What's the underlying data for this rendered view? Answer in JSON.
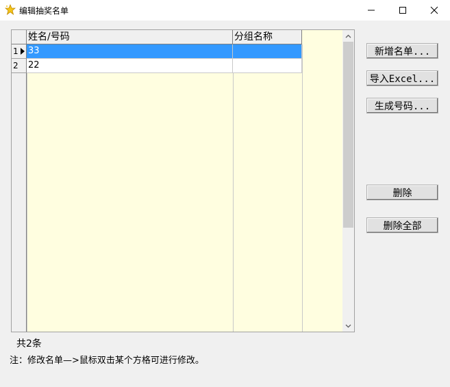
{
  "window": {
    "title": "编辑抽奖名单",
    "icon": "star-icon"
  },
  "grid": {
    "columns": [
      "姓名/号码",
      "分组名称"
    ],
    "rows": [
      {
        "index": "1",
        "name": "33",
        "group": "",
        "selected": true
      },
      {
        "index": "2",
        "name": "22",
        "group": "",
        "selected": false
      }
    ]
  },
  "buttons": {
    "add_list": "新增名单...",
    "import_excel": "导入Excel...",
    "generate_numbers": "生成号码...",
    "delete": "删除",
    "delete_all": "删除全部"
  },
  "footer": {
    "count": "共2条",
    "note": "注：修改名单—>鼠标双击某个方格可进行修改。"
  },
  "colors": {
    "grid_background": "#fffee0",
    "selection": "#3399ff"
  }
}
